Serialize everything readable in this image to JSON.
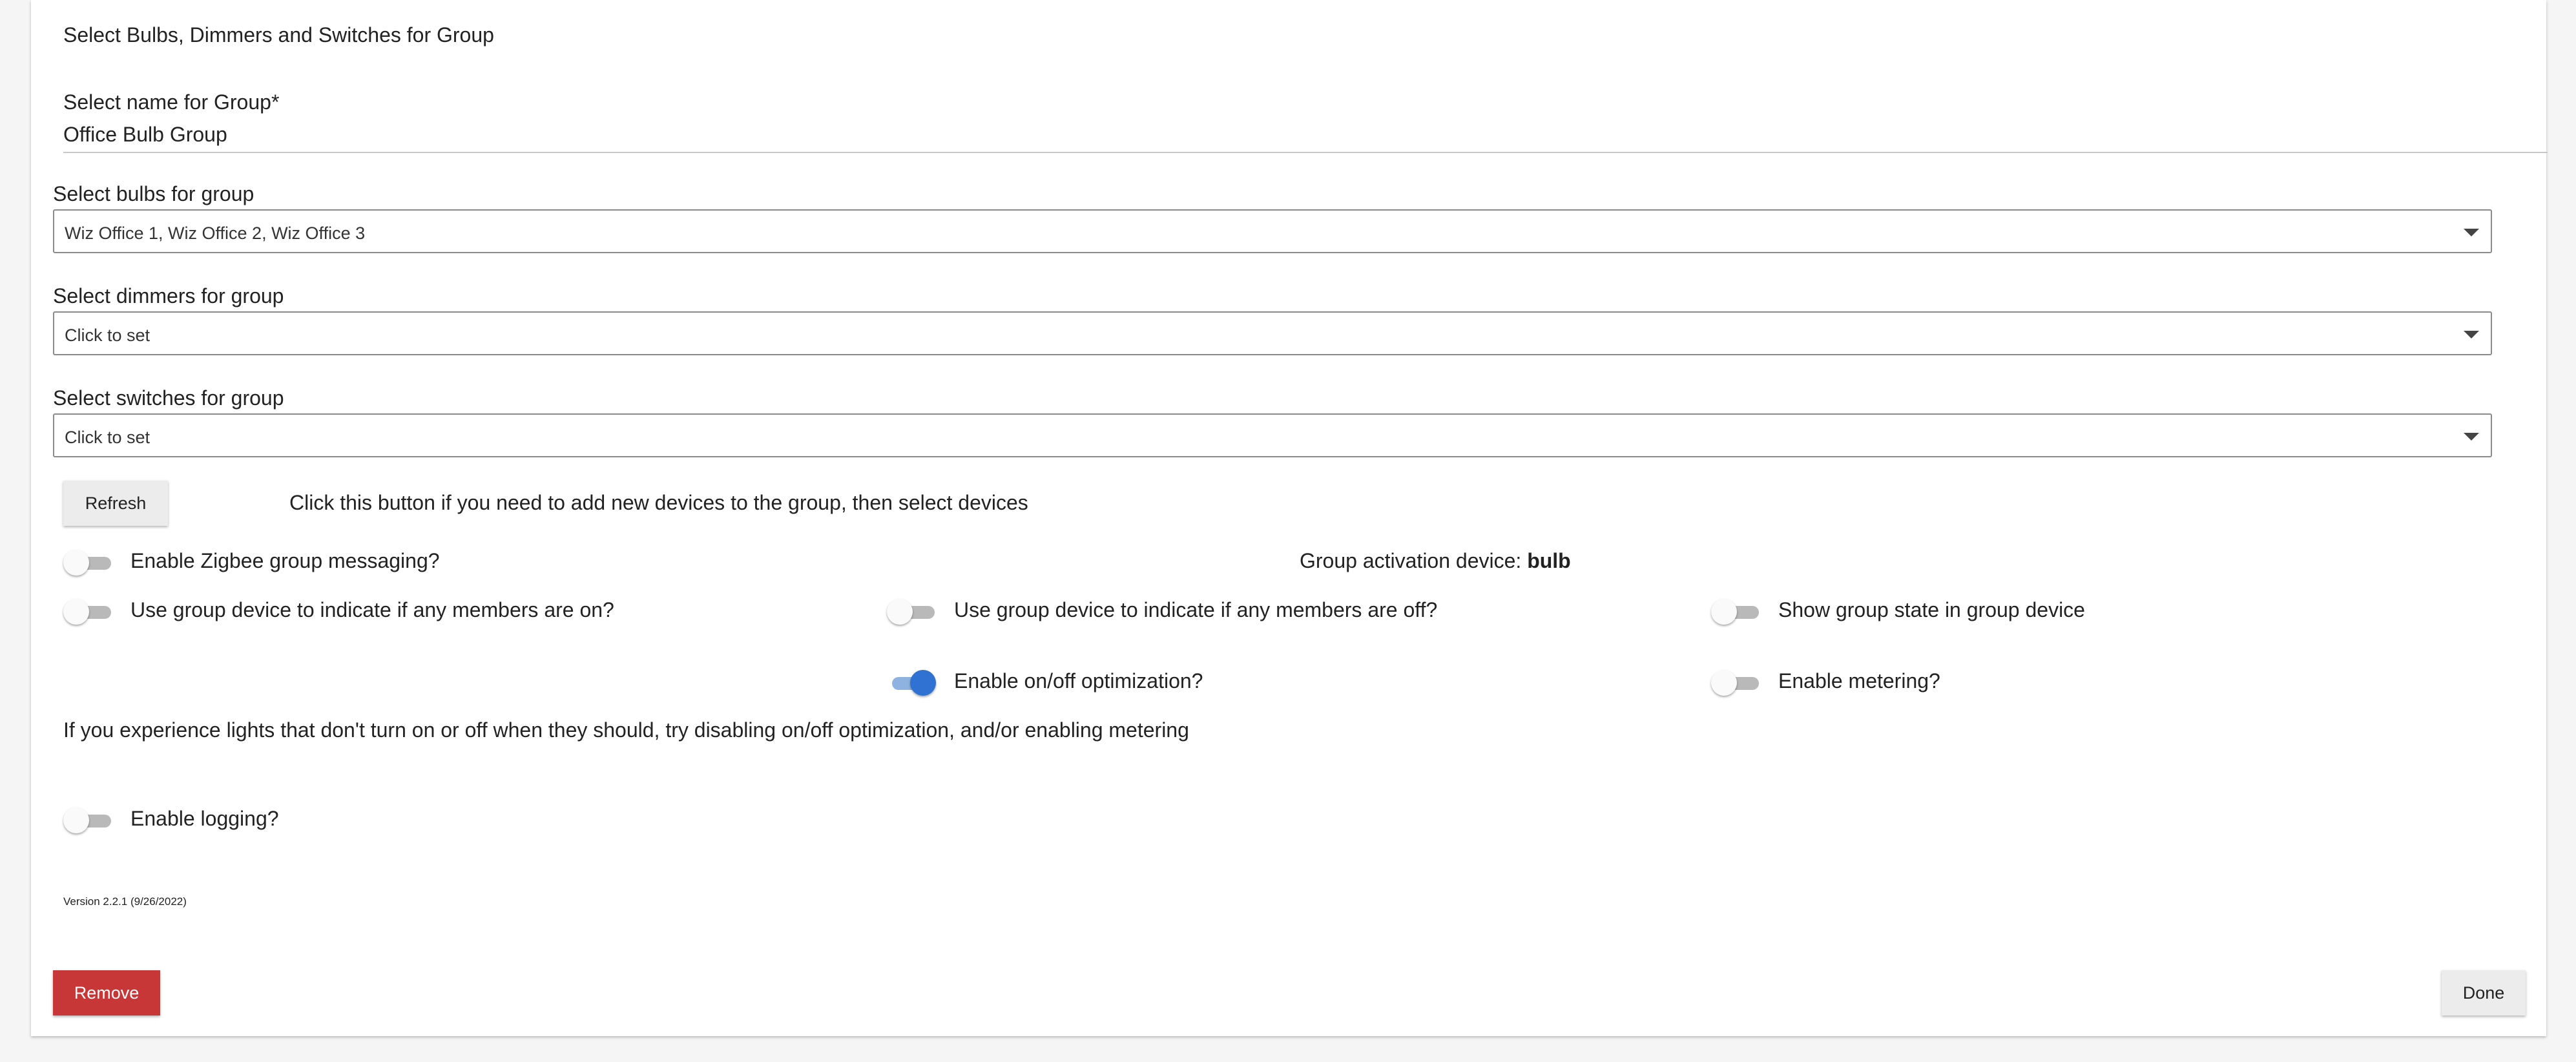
{
  "header": {
    "title": "Select Bulbs, Dimmers and Switches for Group"
  },
  "group_name": {
    "label": "Select name for Group*",
    "value": "Office Bulb Group"
  },
  "bulbs": {
    "label": "Select bulbs for group",
    "value": "Wiz Office 1, Wiz Office 2, Wiz Office 3"
  },
  "dimmers": {
    "label": "Select dimmers for group",
    "value": "Click to set"
  },
  "switches": {
    "label": "Select switches for group",
    "value": "Click to set"
  },
  "refresh": {
    "button_label": "Refresh",
    "hint": "Click this button if you need to add new devices to the group, then select devices"
  },
  "activation": {
    "label": "Group activation device:",
    "value": "bulb"
  },
  "toggles": {
    "zigbee": {
      "label": "Enable Zigbee group messaging?",
      "on": false
    },
    "any_on": {
      "label": "Use group device to indicate if any members are on?",
      "on": false
    },
    "any_off": {
      "label": "Use group device to indicate if any members are off?",
      "on": false
    },
    "show_state": {
      "label": "Show group state in group device",
      "on": false
    },
    "optimization": {
      "label": "Enable on/off optimization?",
      "on": true
    },
    "metering": {
      "label": "Enable metering?",
      "on": false
    },
    "logging": {
      "label": "Enable logging?",
      "on": false
    }
  },
  "optimization_note": "If you experience lights that don't turn on or off when they should, try disabling on/off optimization, and/or enabling metering",
  "version": "Version 2.2.1 (9/26/2022)",
  "footer": {
    "remove_label": "Remove",
    "done_label": "Done"
  },
  "colors": {
    "accent": "#2f72d1",
    "danger": "#c73737",
    "background": "#f5f5f5"
  }
}
